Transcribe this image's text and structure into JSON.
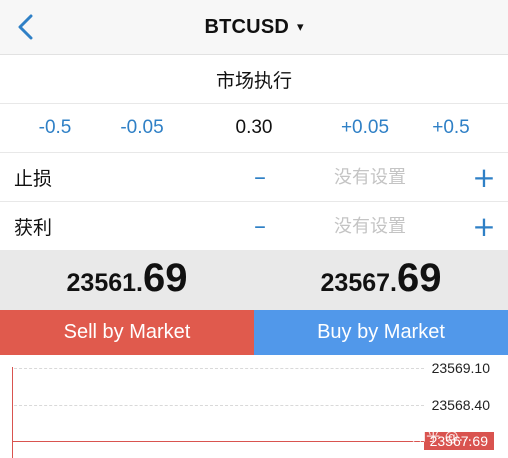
{
  "header": {
    "symbol": "BTCUSD",
    "caret": "▾"
  },
  "execution_mode": "市场执行",
  "volume": {
    "minus_large": "-0.5",
    "minus_small": "-0.05",
    "current": "0.30",
    "plus_small": "+0.05",
    "plus_large": "+0.5"
  },
  "stop_loss": {
    "label": "止损",
    "minus": "–",
    "placeholder": "没有设置",
    "plus": "+"
  },
  "take_profit": {
    "label": "获利",
    "minus": "–",
    "placeholder": "没有设置",
    "plus": "+"
  },
  "bid": {
    "main": "23561.",
    "big": "69"
  },
  "ask": {
    "main": "23567.",
    "big": "69"
  },
  "actions": {
    "sell": "Sell by Market",
    "buy": "Buy by Market"
  },
  "chart": {
    "price_levels": [
      "23569.10",
      "23568.40"
    ],
    "current_price": "23567.69",
    "watermark": "知乎 @..."
  },
  "colors": {
    "accent": "#2f80c6",
    "sell": "#e05a4d",
    "buy": "#5198ea",
    "price_line": "#d9534f"
  },
  "icons": {
    "back": "chevron-left-icon"
  }
}
